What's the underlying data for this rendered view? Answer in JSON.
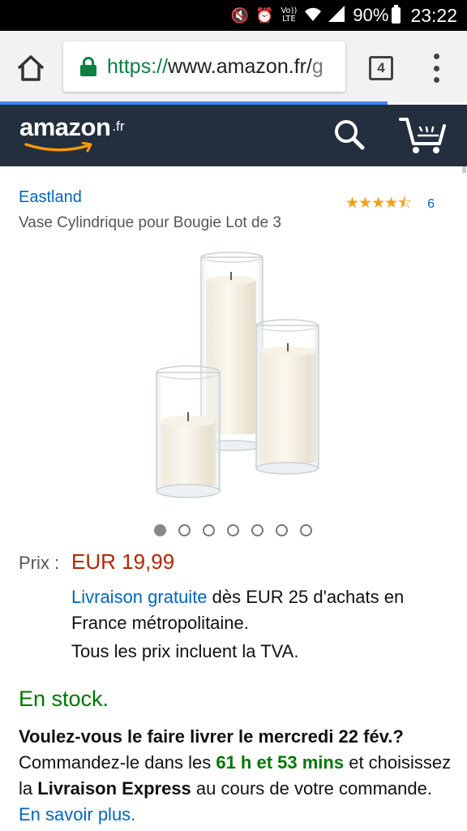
{
  "status_bar": {
    "icons": [
      "mute-icon",
      "alarm-icon",
      "volte-icon",
      "wifi-icon",
      "signal-icon"
    ],
    "volte_label": "Vo)) LTE",
    "battery": "90%",
    "time": "23:22"
  },
  "browser": {
    "url_scheme": "https://",
    "url_host": "www.amazon.fr/",
    "url_rest": "g",
    "tab_count": "4"
  },
  "header": {
    "logo_word": "amazon",
    "logo_tld": ".fr",
    "colors": {
      "background": "#232f3e",
      "smile": "#f90"
    }
  },
  "product": {
    "brand": "Eastland",
    "title": "Vase Cylindrique pour Bougie Lot de 3",
    "rating_stars": 4.5,
    "rating_count": "6",
    "image_count": 7,
    "active_image": 0,
    "price_label": "Prix :",
    "price": "EUR 19,99",
    "shipping_link": "Livraison gratuite",
    "shipping_text": " dès EUR 25 d'achats en France métropolitaine.",
    "vat_note": "Tous les prix incluent la TVA.",
    "stock": "En stock."
  },
  "delivery": {
    "question": "Voulez-vous le faire livrer le mercredi 22 fév.?",
    "text1": "Commandez-le dans les ",
    "countdown": "61 h et 53 mins",
    "text2": " et choisissez la ",
    "express": "Livraison Express",
    "text3": " au cours de votre commande. ",
    "learn_more": "En savoir plus."
  },
  "colors": {
    "link": "#0066c0",
    "price": "#b12704",
    "in_stock": "#007600",
    "stars": "#f0a11c"
  }
}
